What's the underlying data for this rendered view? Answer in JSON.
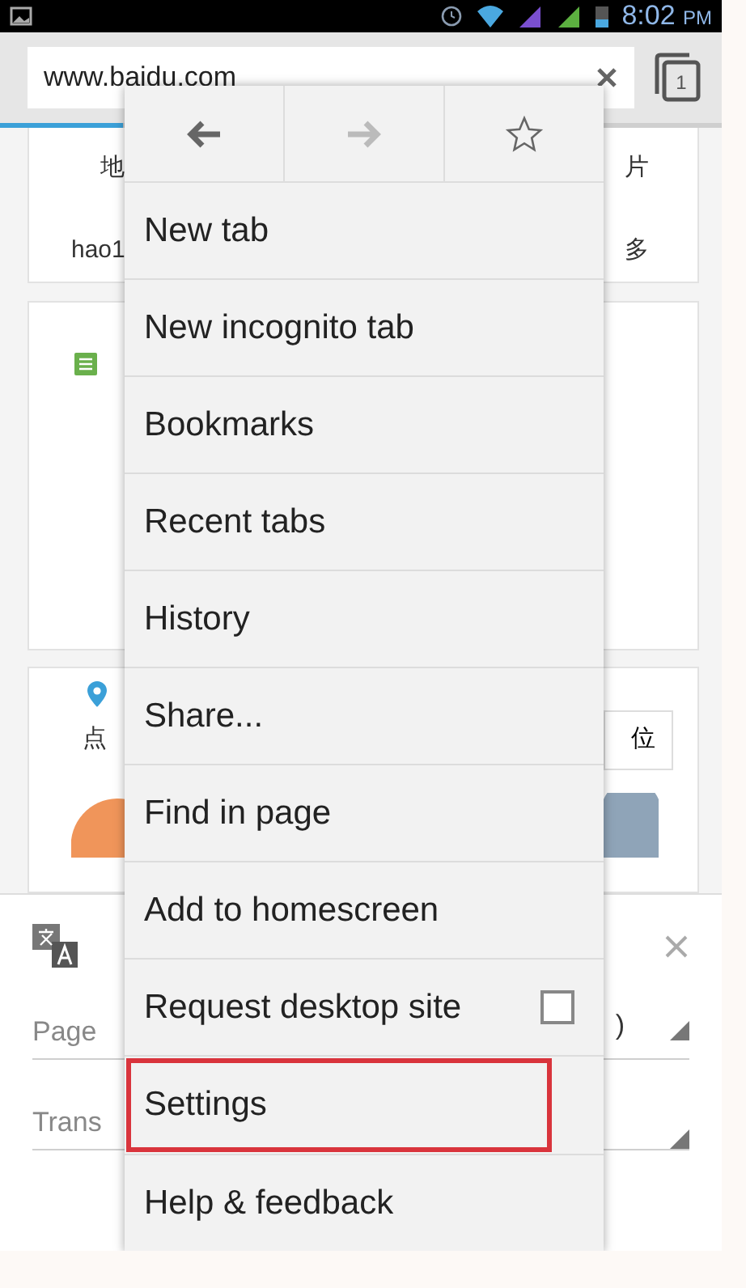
{
  "status_bar": {
    "time": "8:02",
    "suffix": "PM"
  },
  "toolbar": {
    "url": "www.baidu.com",
    "tab_count": "1",
    "progress": {
      "level": 0.17
    }
  },
  "page": {
    "links_left": [
      "地",
      "hao1"
    ],
    "links_right": [
      "片",
      "多"
    ],
    "nearby_text": "点",
    "locate_button": "位"
  },
  "translate_bar": {
    "fields": [
      {
        "label": "Page",
        "value": ")"
      },
      {
        "label": "Trans"
      }
    ]
  },
  "menu": {
    "nav": [
      {
        "kind": "back",
        "disabled": false
      },
      {
        "kind": "forward",
        "disabled": true
      },
      {
        "kind": "star",
        "disabled": false
      }
    ],
    "items": [
      {
        "label": "New tab",
        "kind": "plain",
        "highlighted": false
      },
      {
        "label": "New incognito tab",
        "kind": "plain",
        "highlighted": false
      },
      {
        "label": "Bookmarks",
        "kind": "plain",
        "highlighted": false
      },
      {
        "label": "Recent tabs",
        "kind": "plain",
        "highlighted": false
      },
      {
        "label": "History",
        "kind": "plain",
        "highlighted": false
      },
      {
        "label": "Share...",
        "kind": "plain",
        "highlighted": false
      },
      {
        "label": "Find in page",
        "kind": "plain",
        "highlighted": false
      },
      {
        "label": "Add to homescreen",
        "kind": "plain",
        "highlighted": false
      },
      {
        "label": "Request desktop site",
        "kind": "checkbox",
        "checked": false,
        "highlighted": false
      },
      {
        "label": "Settings",
        "kind": "plain",
        "highlighted": true
      },
      {
        "label": "Help & feedback",
        "kind": "plain",
        "highlighted": false
      }
    ]
  }
}
